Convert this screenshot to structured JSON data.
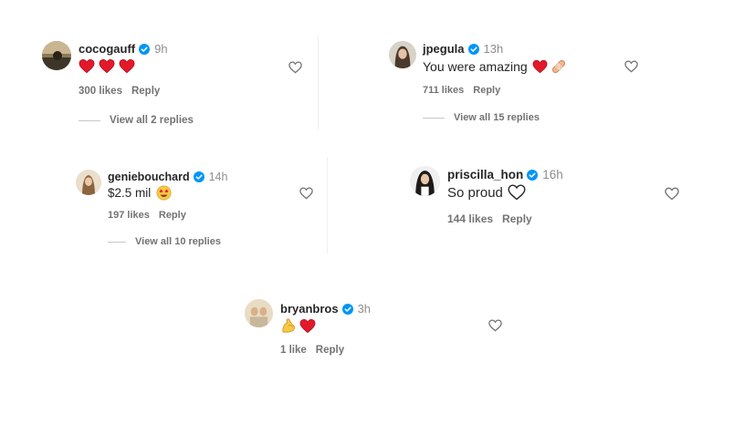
{
  "colors": {
    "verified": "#0095f6",
    "text": "#262626",
    "muted": "#737373",
    "heart_red": "#e3192b"
  },
  "comments": [
    {
      "username": "cocogauff",
      "time": "9h",
      "text": "",
      "emojis": [
        "heart",
        "heart",
        "heart"
      ],
      "likes": "300 likes",
      "reply": "Reply",
      "view_replies": "View all 2 replies"
    },
    {
      "username": "jpegula",
      "time": "13h",
      "text": "You were amazing",
      "emojis": [
        "heart",
        "bandage"
      ],
      "likes": "711 likes",
      "reply": "Reply",
      "view_replies": "View all 15 replies"
    },
    {
      "username": "geniebouchard",
      "time": "14h",
      "text": "$2.5 mil",
      "emojis": [
        "star-struck"
      ],
      "likes": "197 likes",
      "reply": "Reply",
      "view_replies": "View all 10 replies"
    },
    {
      "username": "priscilla_hon",
      "time": "16h",
      "text": "So proud",
      "emojis": [
        "white-heart"
      ],
      "likes": "144 likes",
      "reply": "Reply",
      "view_replies": ""
    },
    {
      "username": "bryanbros",
      "time": "3h",
      "text": "",
      "emojis": [
        "flexed-biceps",
        "heart"
      ],
      "likes": "1 like",
      "reply": "Reply",
      "view_replies": ""
    }
  ]
}
